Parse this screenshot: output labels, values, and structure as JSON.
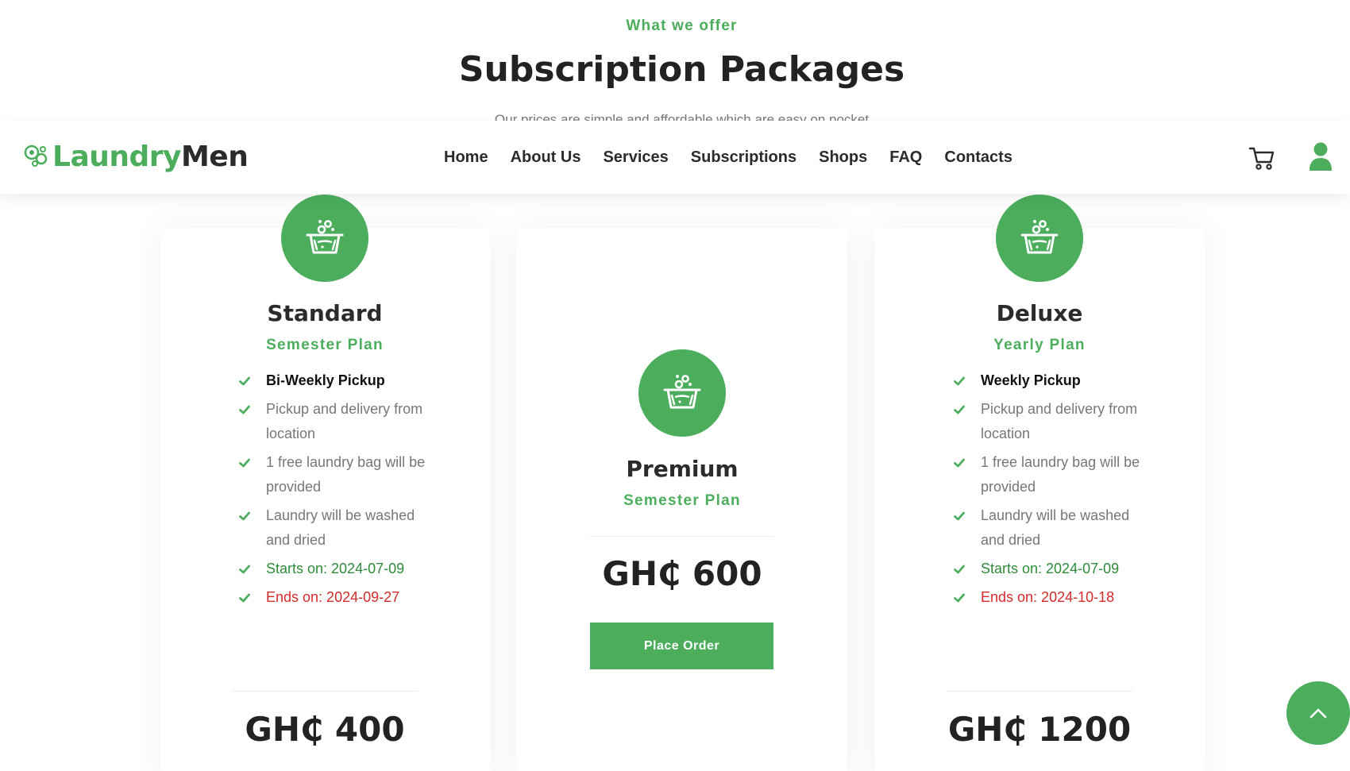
{
  "section": {
    "eyebrow": "What we offer",
    "title": "Subscription Packages",
    "subtitle": "Our prices are simple and affordable which are easy on pocket"
  },
  "navbar": {
    "logo_part1": "Laundry",
    "logo_part2": "Men",
    "links": [
      "Home",
      "About Us",
      "Services",
      "Subscriptions",
      "Shops",
      "FAQ",
      "Contacts"
    ],
    "cart_icon": "cart-icon",
    "user_icon": "user-icon"
  },
  "plans": [
    {
      "name": "Standard",
      "term": "Semester Plan",
      "features": [
        "Bi-Weekly Pickup",
        "Pickup and delivery from location",
        "1 free laundry bag will be provided",
        "Laundry will be washed and dried",
        "Starts on: 2024-07-09",
        "Ends on: 2024-09-27"
      ],
      "price": "GH₵ 400"
    },
    {
      "name": "Premium",
      "term": "Semester Plan",
      "features": [],
      "price": "GH₵ 600",
      "button": "Place Order"
    },
    {
      "name": "Deluxe",
      "term": "Yearly Plan",
      "features": [
        "Weekly Pickup",
        "Pickup and delivery from location",
        "1 free laundry bag will be provided",
        "Laundry will be washed and dried",
        "Starts on: 2024-07-09",
        "Ends on: 2024-10-18"
      ],
      "price": "GH₵ 1200"
    }
  ],
  "colors": {
    "brand_green": "#4cae5d",
    "text_dark": "#2b2b2b",
    "start_green": "#2e8b3a",
    "end_red": "#d42b2b"
  },
  "icons": {
    "plan_badge": "laundry-basin-icon",
    "feature_bullet": "check-icon",
    "scroll_top": "chevron-up-icon"
  }
}
